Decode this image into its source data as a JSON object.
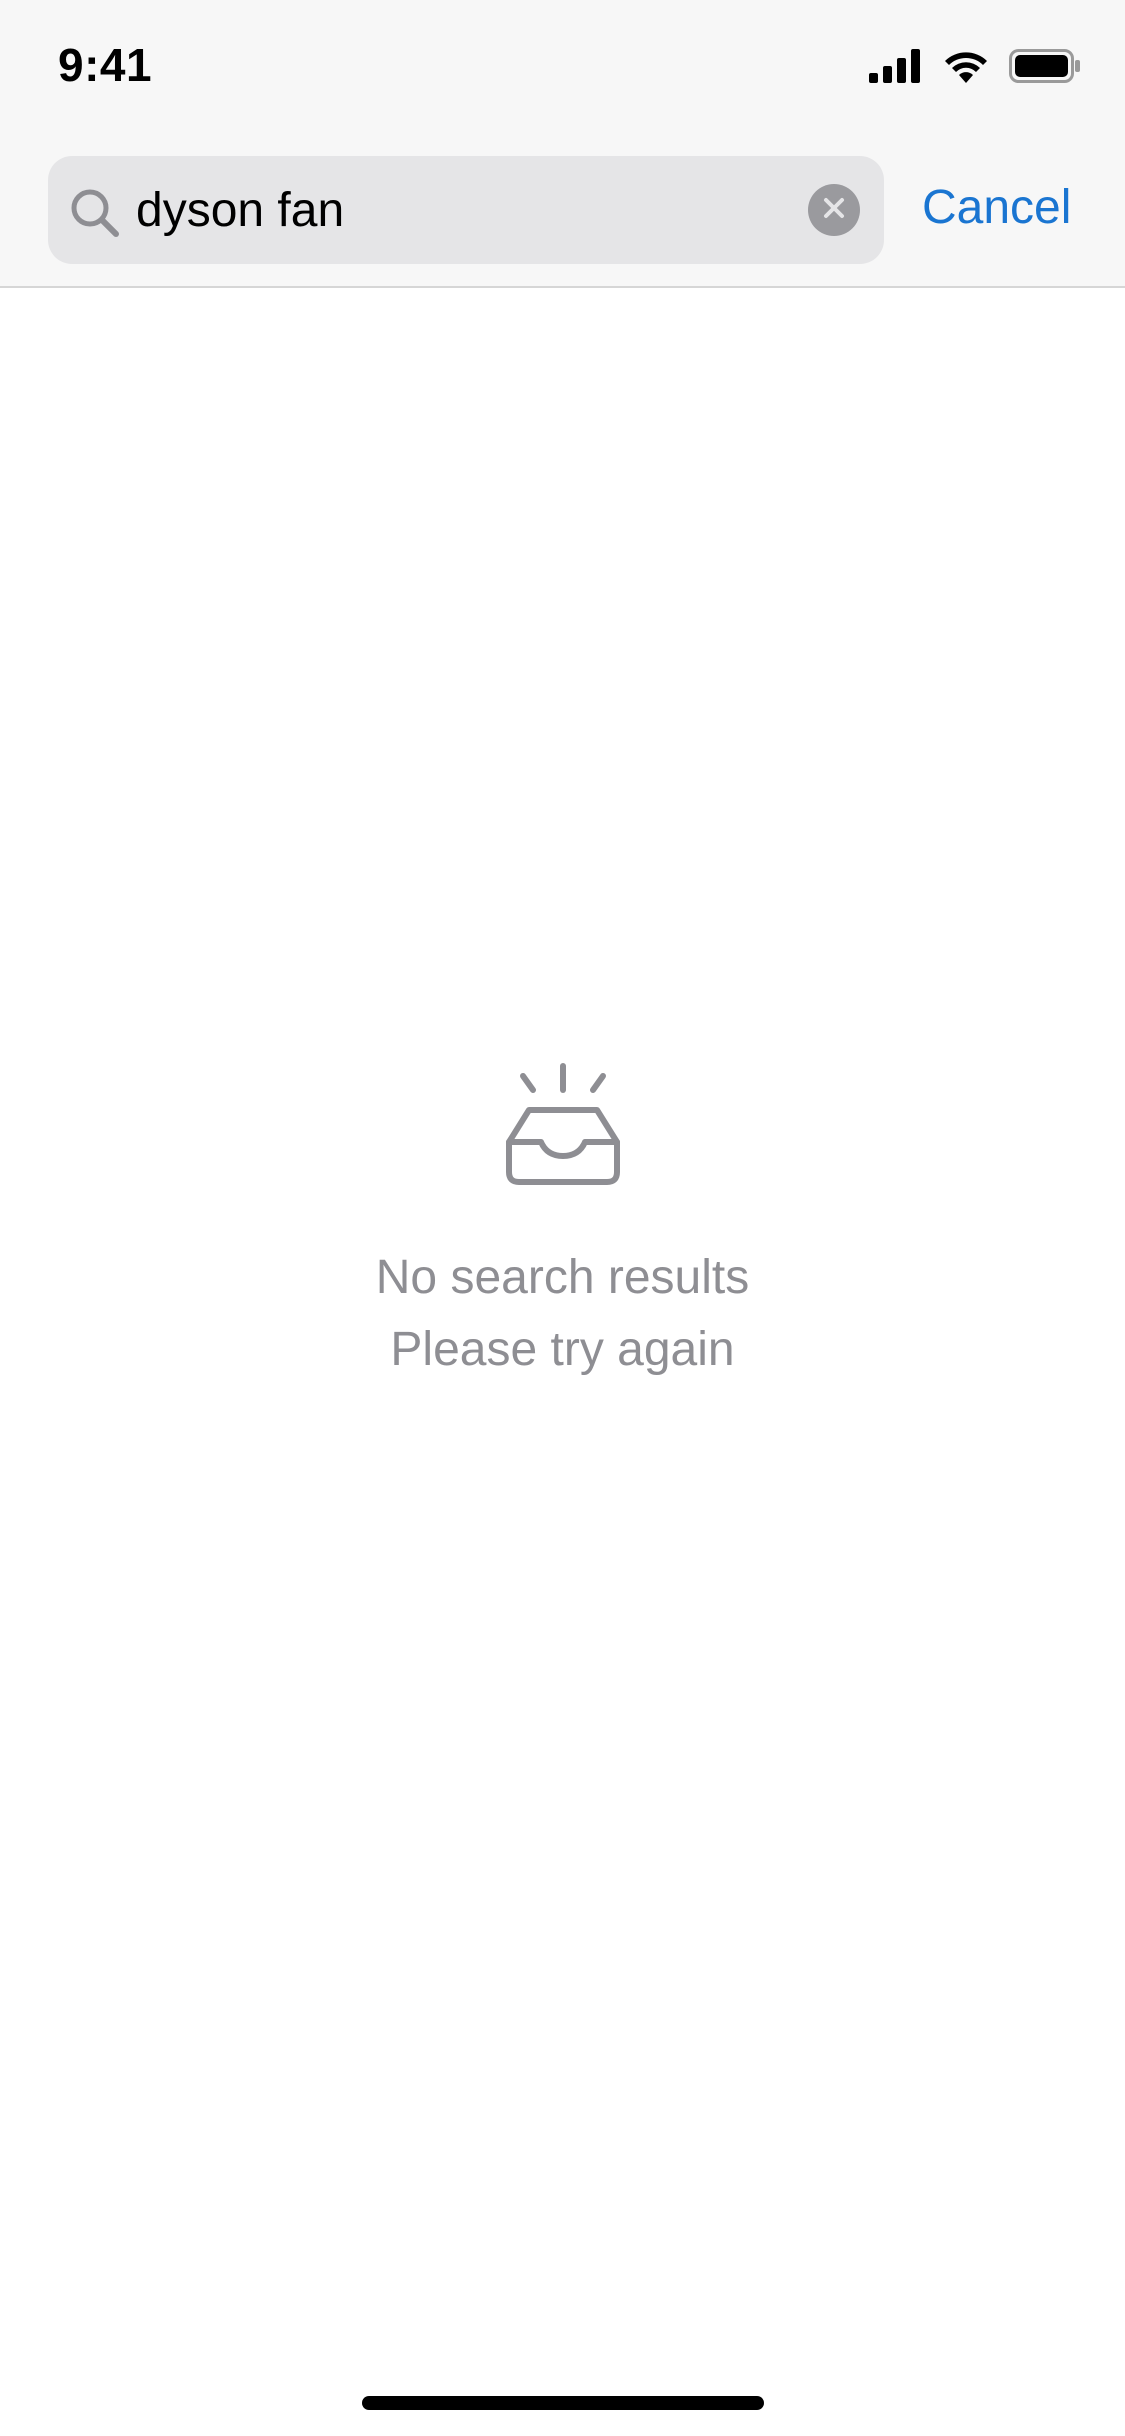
{
  "status_bar": {
    "time": "9:41",
    "icons": [
      "cellular-signal-icon",
      "wifi-icon",
      "battery-icon"
    ]
  },
  "search": {
    "value": "dyson fan",
    "placeholder": "",
    "clear_icon": "clear-icon",
    "search_icon": "search-icon"
  },
  "header": {
    "cancel_label": "Cancel"
  },
  "empty_state": {
    "icon": "empty-inbox-icon",
    "title": "No search results",
    "subtitle": "Please try again"
  },
  "colors": {
    "accent": "#1a75d1",
    "muted_text": "#8e8e93",
    "search_field_bg": "#e5e5e7",
    "header_bg": "#f7f7f7"
  }
}
